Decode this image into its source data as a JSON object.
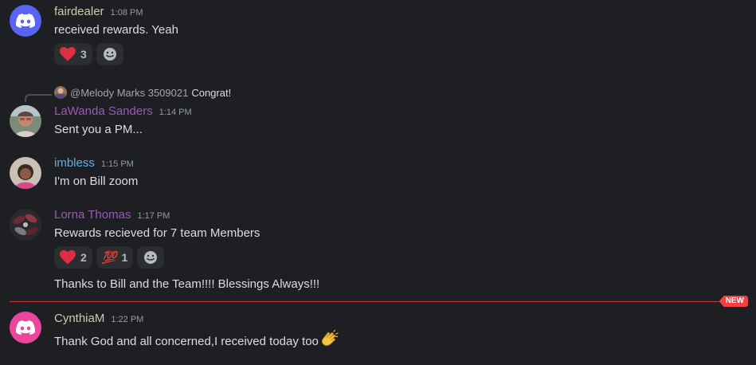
{
  "colors": {
    "background": "#1e1f22",
    "new_line": "#f23f43",
    "username_fairdealer": "#c9cdb0",
    "username_lawanda": "#9b59b6",
    "username_imbless": "#5fb0e8",
    "username_lorna": "#9b59b6",
    "username_cynthia": "#c9cdb0",
    "discord_blurple": "#5865f2",
    "discord_pink": "#eb459e"
  },
  "messages": [
    {
      "username": "fairdealer",
      "time": "1:08 PM",
      "text": "received rewards.  Yeah",
      "avatar_icon": "discord-logo-icon",
      "reactions": [
        {
          "emoji": "heart-icon",
          "count": "3"
        }
      ]
    },
    {
      "reply_to": {
        "name": "@Melody Marks 3509021",
        "text": "Congrat!"
      },
      "username": "LaWanda Sanders",
      "time": "1:14 PM",
      "text": "Sent you a PM..."
    },
    {
      "username": "imbless",
      "time": "1:15 PM",
      "text": "I'm  on Bill zoom"
    },
    {
      "username": "Lorna Thomas",
      "time": "1:17 PM",
      "text": "Rewards recieved for 7 team Members",
      "reactions": [
        {
          "emoji": "heart-icon",
          "count": "2"
        },
        {
          "emoji": "hundred-points-icon",
          "label": "💯",
          "count": "1"
        }
      ],
      "followup": "Thanks to Bill and the Team!!!! Blessings Always!!!"
    },
    {
      "username": "CynthiaM",
      "time": "1:22 PM",
      "text": "Thank God and all concerned,I received today too",
      "avatar_icon": "discord-logo-icon"
    }
  ],
  "new_badge": "NEW"
}
